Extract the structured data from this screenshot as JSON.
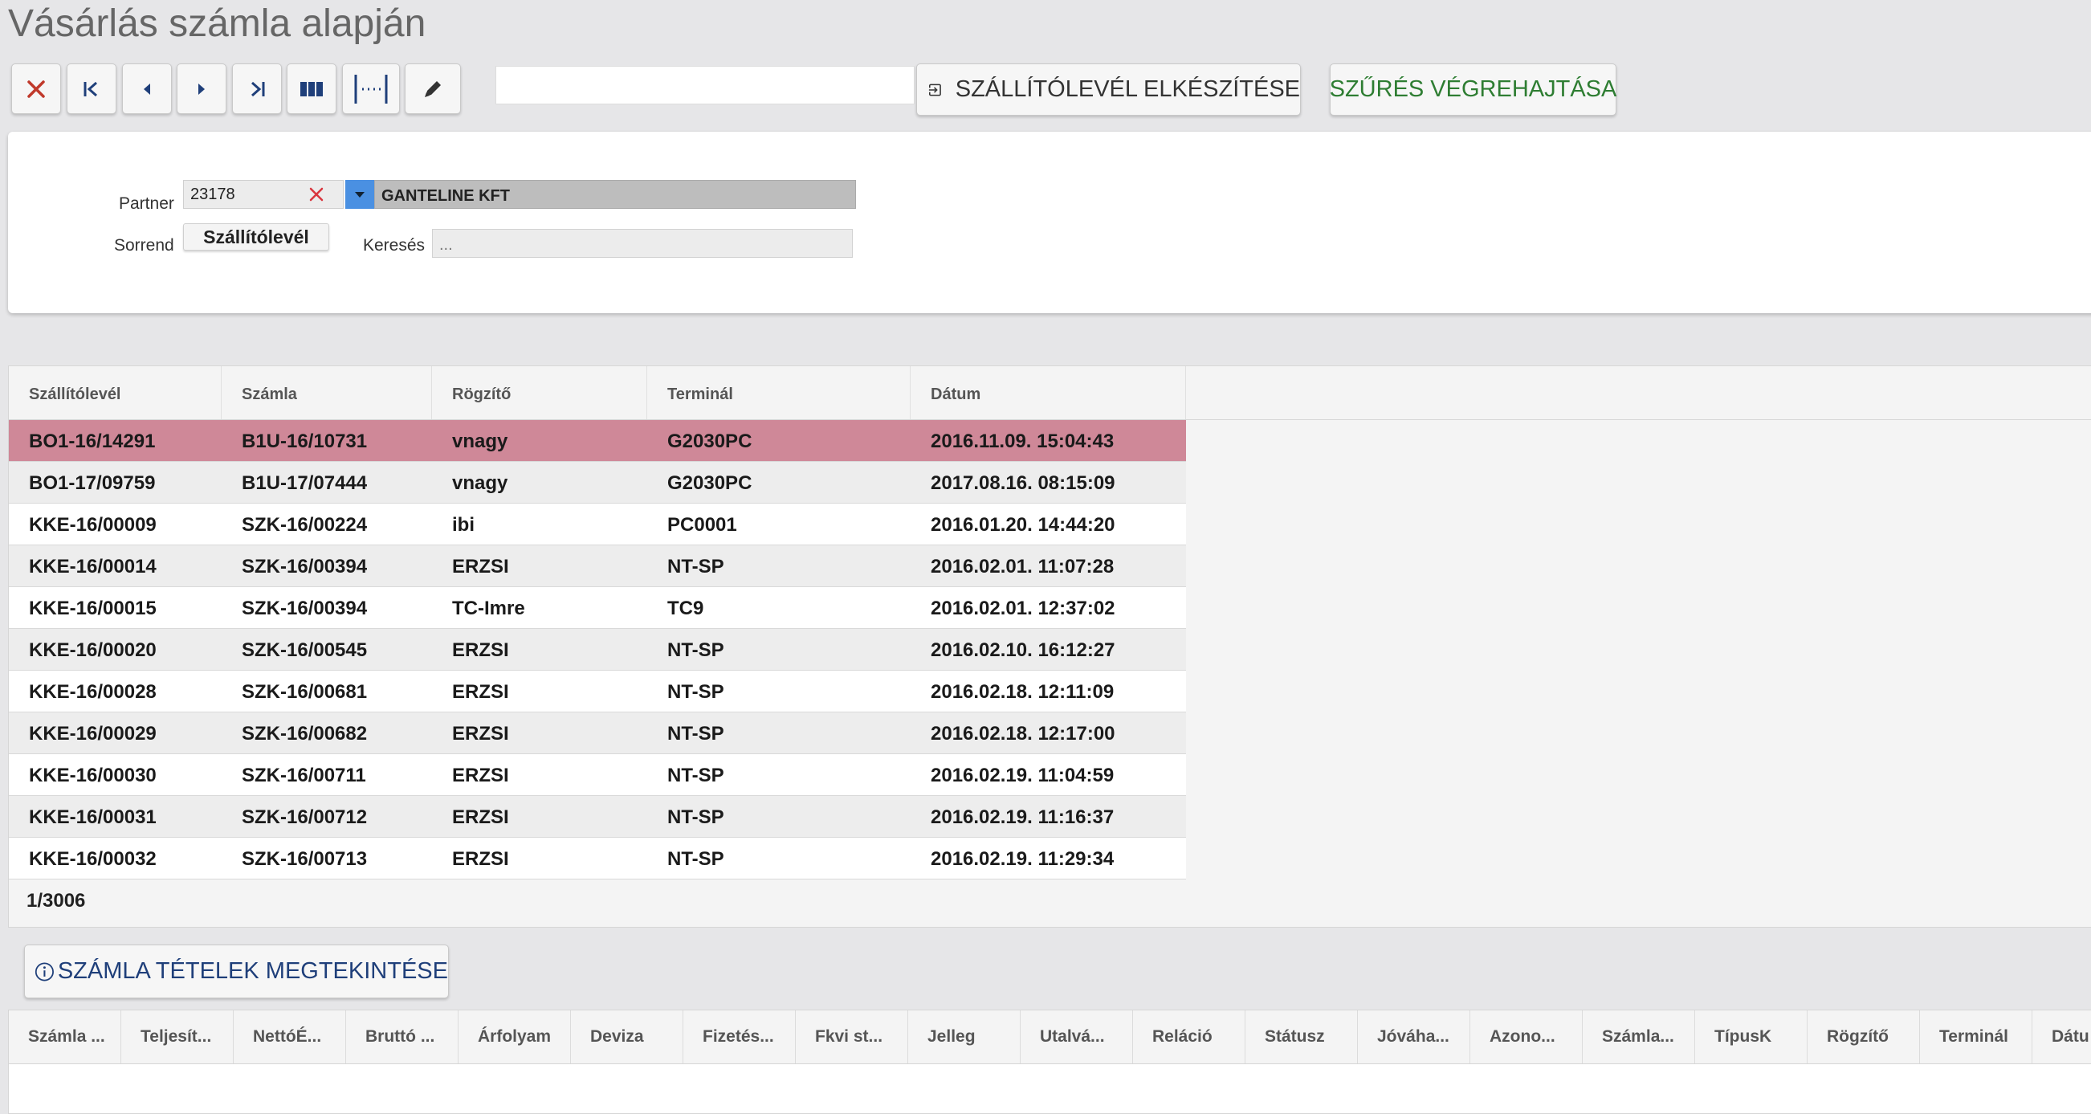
{
  "page": {
    "title": "Vásárlás számla alapján"
  },
  "toolbar": {
    "buttons": [
      "close-icon",
      "first-icon",
      "prev-icon",
      "next-icon",
      "last-icon",
      "columns-icon",
      "column-width-icon",
      "edit-icon"
    ],
    "top_input_value": "",
    "delivery_button_label": "SZÁLLÍTÓLEVÉL ELKÉSZÍTÉSE",
    "filter_button_label": "SZŰRÉS VÉGREHAJTÁSA"
  },
  "filter": {
    "partner_label": "Partner",
    "partner_code": "23178",
    "partner_name": "GANTELINE KFT",
    "sort_label": "Sorrend",
    "sort_value": "Szállítólevél",
    "search_label": "Keresés",
    "search_placeholder": "..."
  },
  "grid": {
    "columns": [
      "Szállítólevél",
      "Számla",
      "Rögzítő",
      "Terminál",
      "Dátum"
    ],
    "rows": [
      [
        "BO1-16/14291",
        "B1U-16/10731",
        "vnagy",
        "G2030PC",
        "2016.11.09. 15:04:43"
      ],
      [
        "BO1-17/09759",
        "B1U-17/07444",
        "vnagy",
        "G2030PC",
        "2017.08.16. 08:15:09"
      ],
      [
        "KKE-16/00009",
        "SZK-16/00224",
        "ibi",
        "PC0001",
        "2016.01.20. 14:44:20"
      ],
      [
        "KKE-16/00014",
        "SZK-16/00394",
        "ERZSI",
        "NT-SP",
        "2016.02.01. 11:07:28"
      ],
      [
        "KKE-16/00015",
        "SZK-16/00394",
        "TC-Imre",
        "TC9",
        "2016.02.01. 12:37:02"
      ],
      [
        "KKE-16/00020",
        "SZK-16/00545",
        "ERZSI",
        "NT-SP",
        "2016.02.10. 16:12:27"
      ],
      [
        "KKE-16/00028",
        "SZK-16/00681",
        "ERZSI",
        "NT-SP",
        "2016.02.18. 12:11:09"
      ],
      [
        "KKE-16/00029",
        "SZK-16/00682",
        "ERZSI",
        "NT-SP",
        "2016.02.18. 12:17:00"
      ],
      [
        "KKE-16/00030",
        "SZK-16/00711",
        "ERZSI",
        "NT-SP",
        "2016.02.19. 11:04:59"
      ],
      [
        "KKE-16/00031",
        "SZK-16/00712",
        "ERZSI",
        "NT-SP",
        "2016.02.19. 11:16:37"
      ],
      [
        "KKE-16/00032",
        "SZK-16/00713",
        "ERZSI",
        "NT-SP",
        "2016.02.19. 11:29:34"
      ]
    ],
    "selected_row": 0,
    "pager": "1/3006"
  },
  "details": {
    "button_label": "SZÁMLA TÉTELEK MEGTEKINTÉSE",
    "columns": [
      "Számla ...",
      "Teljesít...",
      "NettóÉ...",
      "Bruttó ...",
      "Árfolyam",
      "Deviza",
      "Fizetés...",
      "Fkvi st...",
      "Jelleg",
      "Utalvá...",
      "Reláció",
      "Státusz",
      "Jóváha...",
      "Azono...",
      "Számla...",
      "TípusK",
      "Rögzítő",
      "Terminál",
      "Dátu"
    ]
  },
  "colors": {
    "selected_row": "#cf8898",
    "filter_text": "#2e7d32",
    "close_red": "#c0392b",
    "nav_blue": "#1f3f7a",
    "dropdown_blue": "#4a90e2"
  }
}
